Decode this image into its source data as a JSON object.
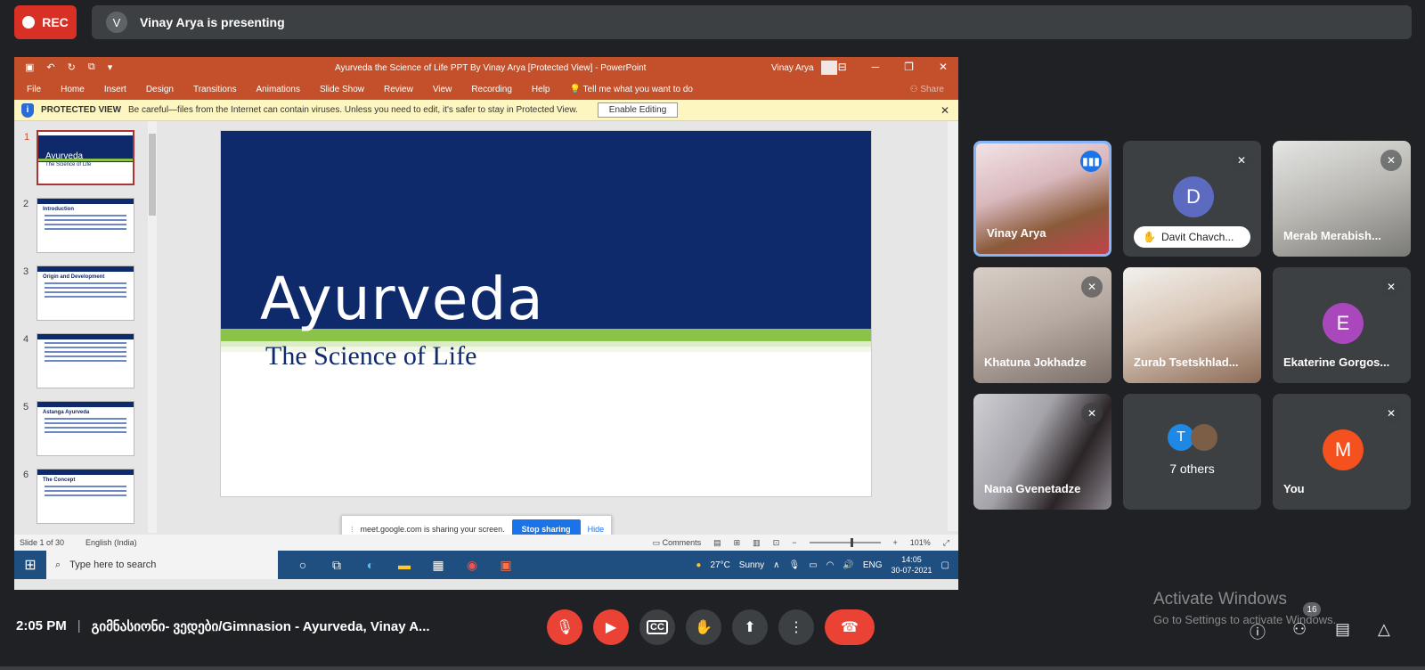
{
  "top": {
    "rec_label": "REC",
    "presenter_initial": "V",
    "presenting_text": "Vinay Arya is presenting"
  },
  "ppt": {
    "window_title": "Ayurveda the Science of Life PPT By Vinay  Arya [Protected View]  -  PowerPoint",
    "user_name": "Vinay Arya",
    "ribbon_tabs": [
      "File",
      "Home",
      "Insert",
      "Design",
      "Transitions",
      "Animations",
      "Slide Show",
      "Review",
      "View",
      "Recording",
      "Help"
    ],
    "tell_me": "Tell me what you want to do",
    "share_label": "Share",
    "protected_label": "PROTECTED VIEW",
    "protected_message": "Be careful—files from the Internet can contain viruses. Unless you need to edit, it's safer to stay in Protected View.",
    "enable_editing": "Enable Editing",
    "thumbnails": [
      {
        "num": "1",
        "title": "Ayurveda",
        "subtitle": "The Science of Life"
      },
      {
        "num": "2",
        "title": "Introduction"
      },
      {
        "num": "3",
        "title": "Origin and Development"
      },
      {
        "num": "4",
        "title": ""
      },
      {
        "num": "5",
        "title": "Astanga Ayurveda"
      },
      {
        "num": "6",
        "title": "The Concept"
      }
    ],
    "slide_title": "Ayurveda",
    "slide_subtitle": "The Science of Life",
    "status_slide": "Slide 1 of 30",
    "status_language": "English (India)",
    "status_comments": "Comments",
    "zoom": "101%"
  },
  "sharebar": {
    "message": "meet.google.com is sharing your screen.",
    "stop": "Stop sharing",
    "hide": "Hide"
  },
  "taskbar": {
    "search_placeholder": "Type here to search",
    "weather_temp": "27°C",
    "weather_desc": "Sunny",
    "lang": "ENG",
    "time": "14:05",
    "date": "30-07-2021"
  },
  "participants": [
    {
      "name": "Vinay Arya"
    },
    {
      "name": "Davit Chavch...",
      "initial": "D",
      "color": "#5c6bc0"
    },
    {
      "name": "Merab Merabish..."
    },
    {
      "name": "Khatuna Jokhadze"
    },
    {
      "name": "Zurab Tsetskhlad..."
    },
    {
      "name": "Ekaterine Gorgos...",
      "initial": "E",
      "color": "#ab47bc"
    },
    {
      "name": "Nana Gvenetadze"
    },
    {
      "name": "7 others",
      "initial": "T",
      "color": "#1e88e5"
    },
    {
      "name": "You",
      "initial": "M",
      "color": "#f4511e"
    }
  ],
  "bottom": {
    "time": "2:05 PM",
    "meeting": "გიმნასიონი- ვედები/Gimnasion - Ayurveda, Vinay A...",
    "participant_count": "16",
    "activate_title": "Activate Windows",
    "activate_sub": "Go to Settings to activate Windows."
  }
}
